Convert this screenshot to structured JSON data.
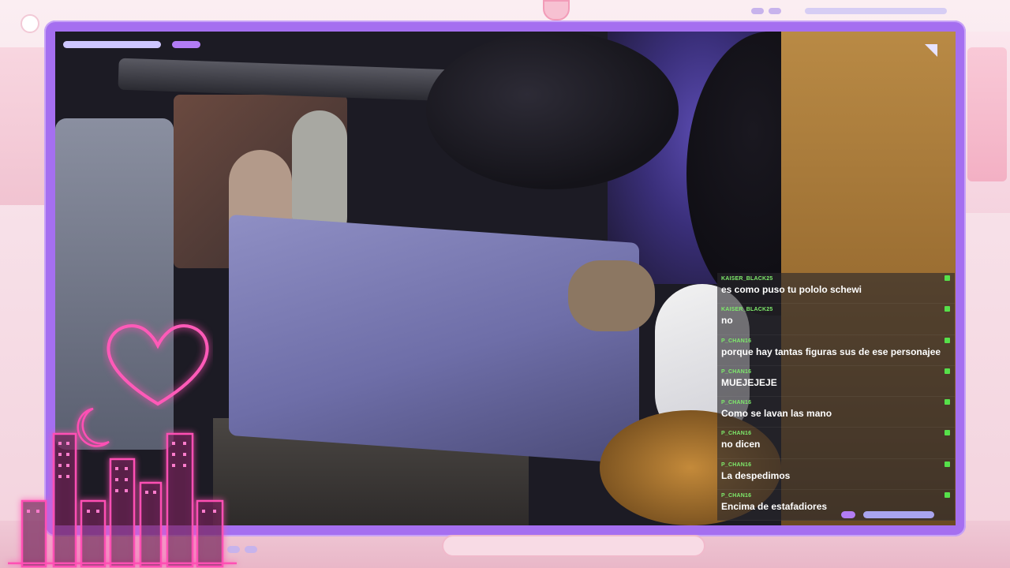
{
  "colors": {
    "frame": "#a56ff0",
    "chat_username": "#7eea6b",
    "chat_text": "#ffffff",
    "neon_pink": "#ff4fb4",
    "accent_lavender": "#c7b3ec"
  },
  "chat": {
    "messages": [
      {
        "user": "KAISER_BLACK25",
        "text": "es como puso tu pololo schewi"
      },
      {
        "user": "KAISER_BLACK25",
        "text": "no"
      },
      {
        "user": "P_CHAN16",
        "text": "porque hay tantas figuras sus de ese personajee"
      },
      {
        "user": "P_CHAN16",
        "text": "MUEJEJEJE"
      },
      {
        "user": "P_CHAN16",
        "text": "Como se lavan las mano"
      },
      {
        "user": "P_CHAN16",
        "text": "no dicen"
      },
      {
        "user": "P_CHAN16",
        "text": "La despedimos"
      },
      {
        "user": "P_CHAN16",
        "text": "Encima de estafadiores"
      }
    ]
  },
  "icons": {
    "chat_badge": "green-badge-icon",
    "neon_heart": "heart-icon",
    "neon_moon": "moon-icon",
    "neon_city": "city-skyline-icon"
  }
}
